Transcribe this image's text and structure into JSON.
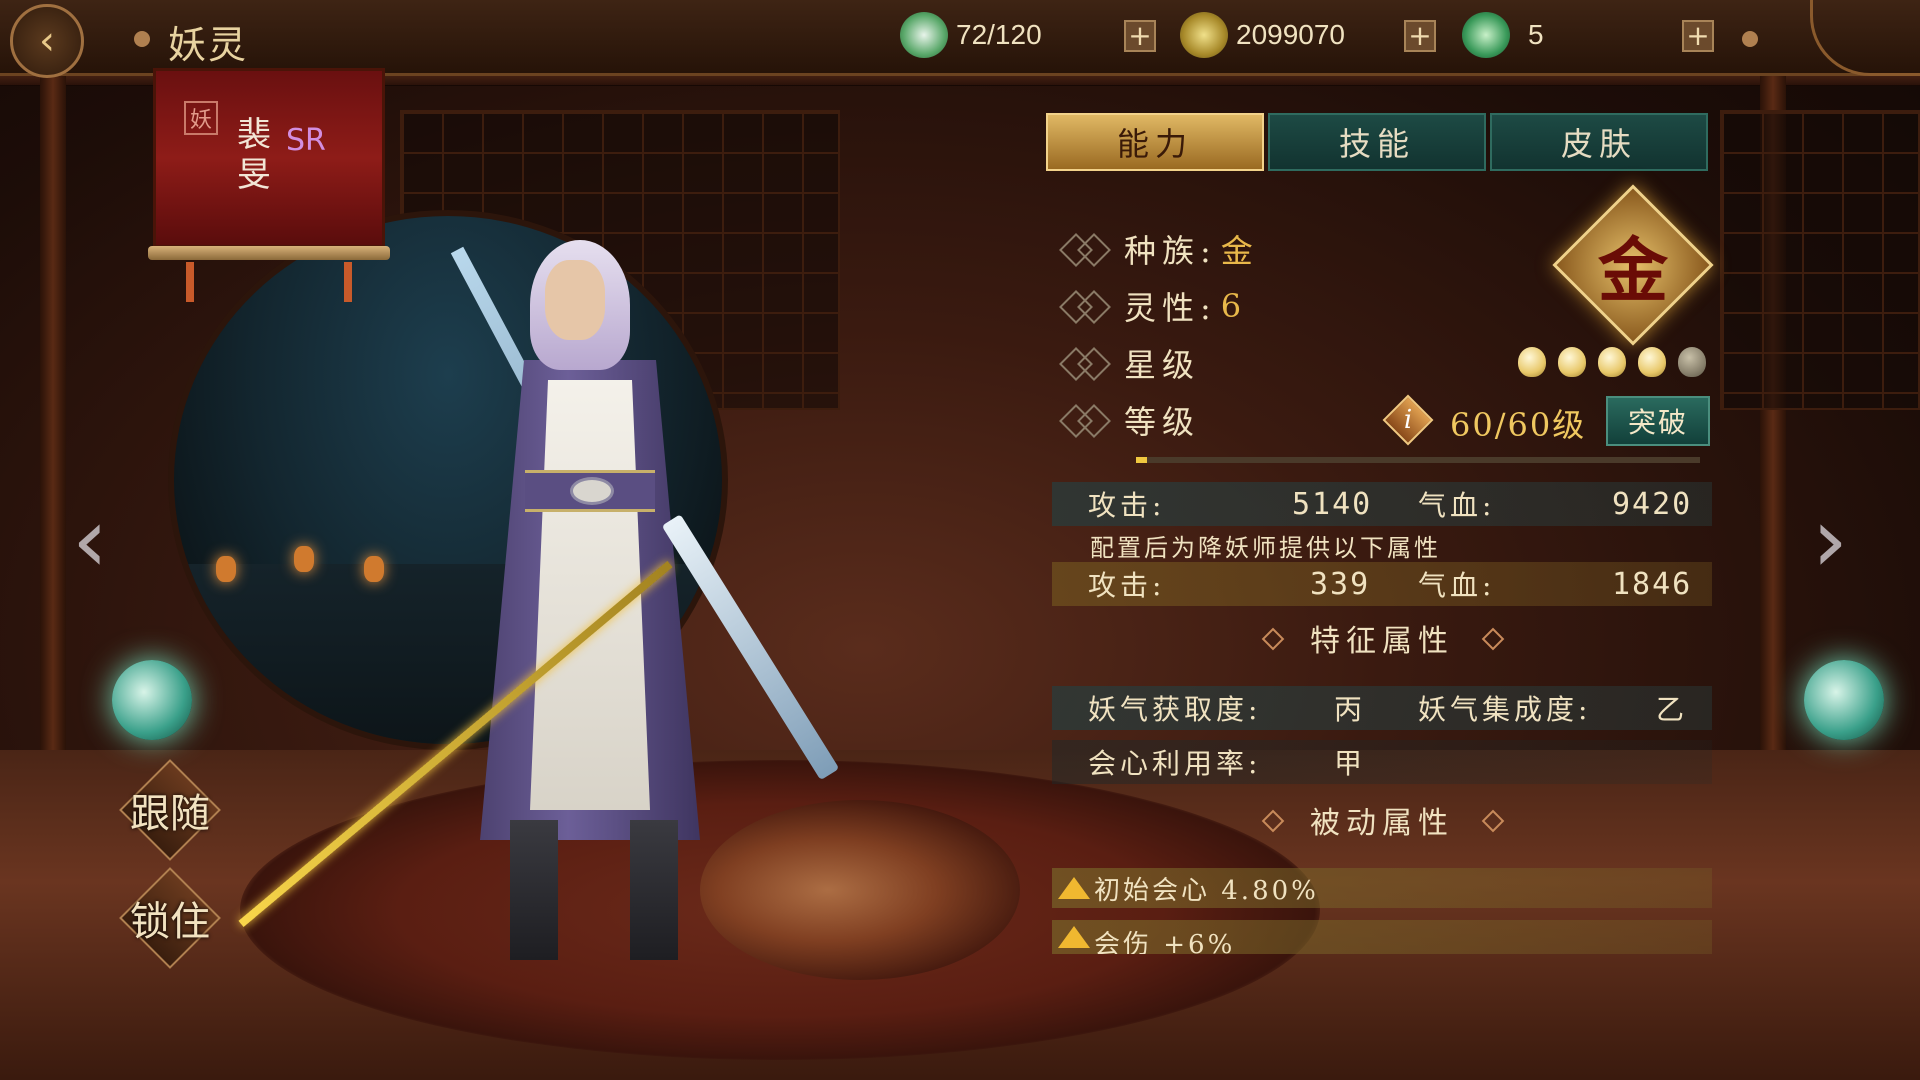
{
  "header": {
    "title": "妖灵",
    "resources": [
      {
        "icon": "stamina-icon",
        "value": "72/120"
      },
      {
        "icon": "coin-icon",
        "value": "2099070"
      },
      {
        "icon": "jade-icon",
        "value": "5"
      }
    ]
  },
  "banner": {
    "seal": "妖",
    "name": "裴旻",
    "rarity": "SR"
  },
  "side": {
    "follow_label": "跟随",
    "lock_label": "锁住"
  },
  "tabs": [
    {
      "label": "能力",
      "active": true
    },
    {
      "label": "技能",
      "active": false
    },
    {
      "label": "皮肤",
      "active": false
    }
  ],
  "attributes": {
    "race_label": "种族:",
    "race_value": "金",
    "spirit_label": "灵性:",
    "spirit_value": "6",
    "star_label": "星级",
    "stars_filled": 4,
    "stars_total": 5,
    "level_label": "等级",
    "level_value": "60/60级",
    "level_progress": 0.02,
    "breakthrough_label": "突破",
    "emblem_glyph": "金"
  },
  "stats": {
    "attack_label": "攻击:",
    "attack_value": "5140",
    "hp_label": "气血:",
    "hp_value": "9420",
    "config_note": "配置后为降妖师提供以下属性",
    "bonus_attack_label": "攻击:",
    "bonus_attack_value": "339",
    "bonus_hp_label": "气血:",
    "bonus_hp_value": "1846"
  },
  "traits": {
    "title": "特征属性",
    "acquire_label": "妖气获取度:",
    "acquire_value": "丙",
    "integrate_label": "妖气集成度:",
    "integrate_value": "乙",
    "crit_usage_label": "会心利用率:",
    "crit_usage_value": "甲"
  },
  "passives": {
    "title": "被动属性",
    "items": [
      {
        "text": "初始会心 4.80%"
      },
      {
        "text": "会伤 +6%"
      }
    ]
  },
  "colors": {
    "accent_gold": "#e8b84a",
    "tab_active": "#e0b864",
    "tab_inactive": "#1d4a44"
  }
}
